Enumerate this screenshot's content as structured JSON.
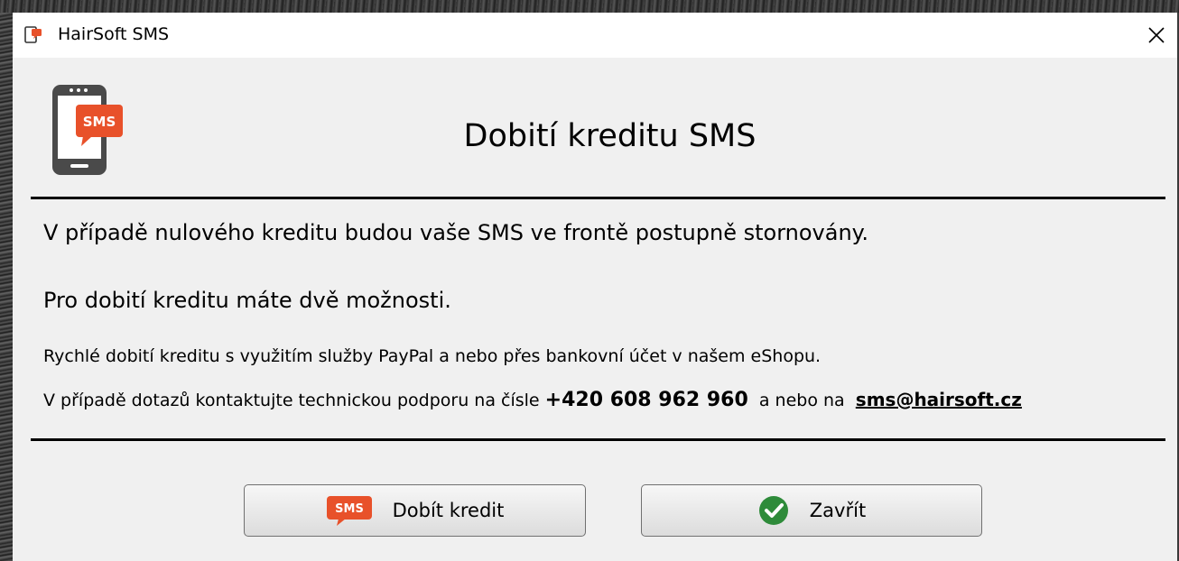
{
  "window": {
    "title": "HairSoft SMS"
  },
  "header": {
    "icon": "phone-sms-icon",
    "title": "Dobití kreditu SMS"
  },
  "body": {
    "line1": "V případě nulového kreditu budou vaše SMS ve frontě postupně stornovány.",
    "line2": "Pro dobití kreditu máte dvě možnosti.",
    "line3": "Rychlé dobití kreditu s využitím služby PayPal a nebo přes bankovní účet v našem eShopu.",
    "line4_prefix": "V případě dotazů kontaktujte technickou podporu na čísle",
    "phone": "+420 608 962 960",
    "line4_middle": "a nebo na",
    "email": "sms@hairsoft.cz"
  },
  "buttons": {
    "topup_badge": "SMS",
    "topup_label": "Dobít kredit",
    "close_label": "Zavřít"
  },
  "colors": {
    "accent_orange": "#e8512a",
    "success_green": "#2e8b3a",
    "phone_gray": "#4a4a4a"
  }
}
